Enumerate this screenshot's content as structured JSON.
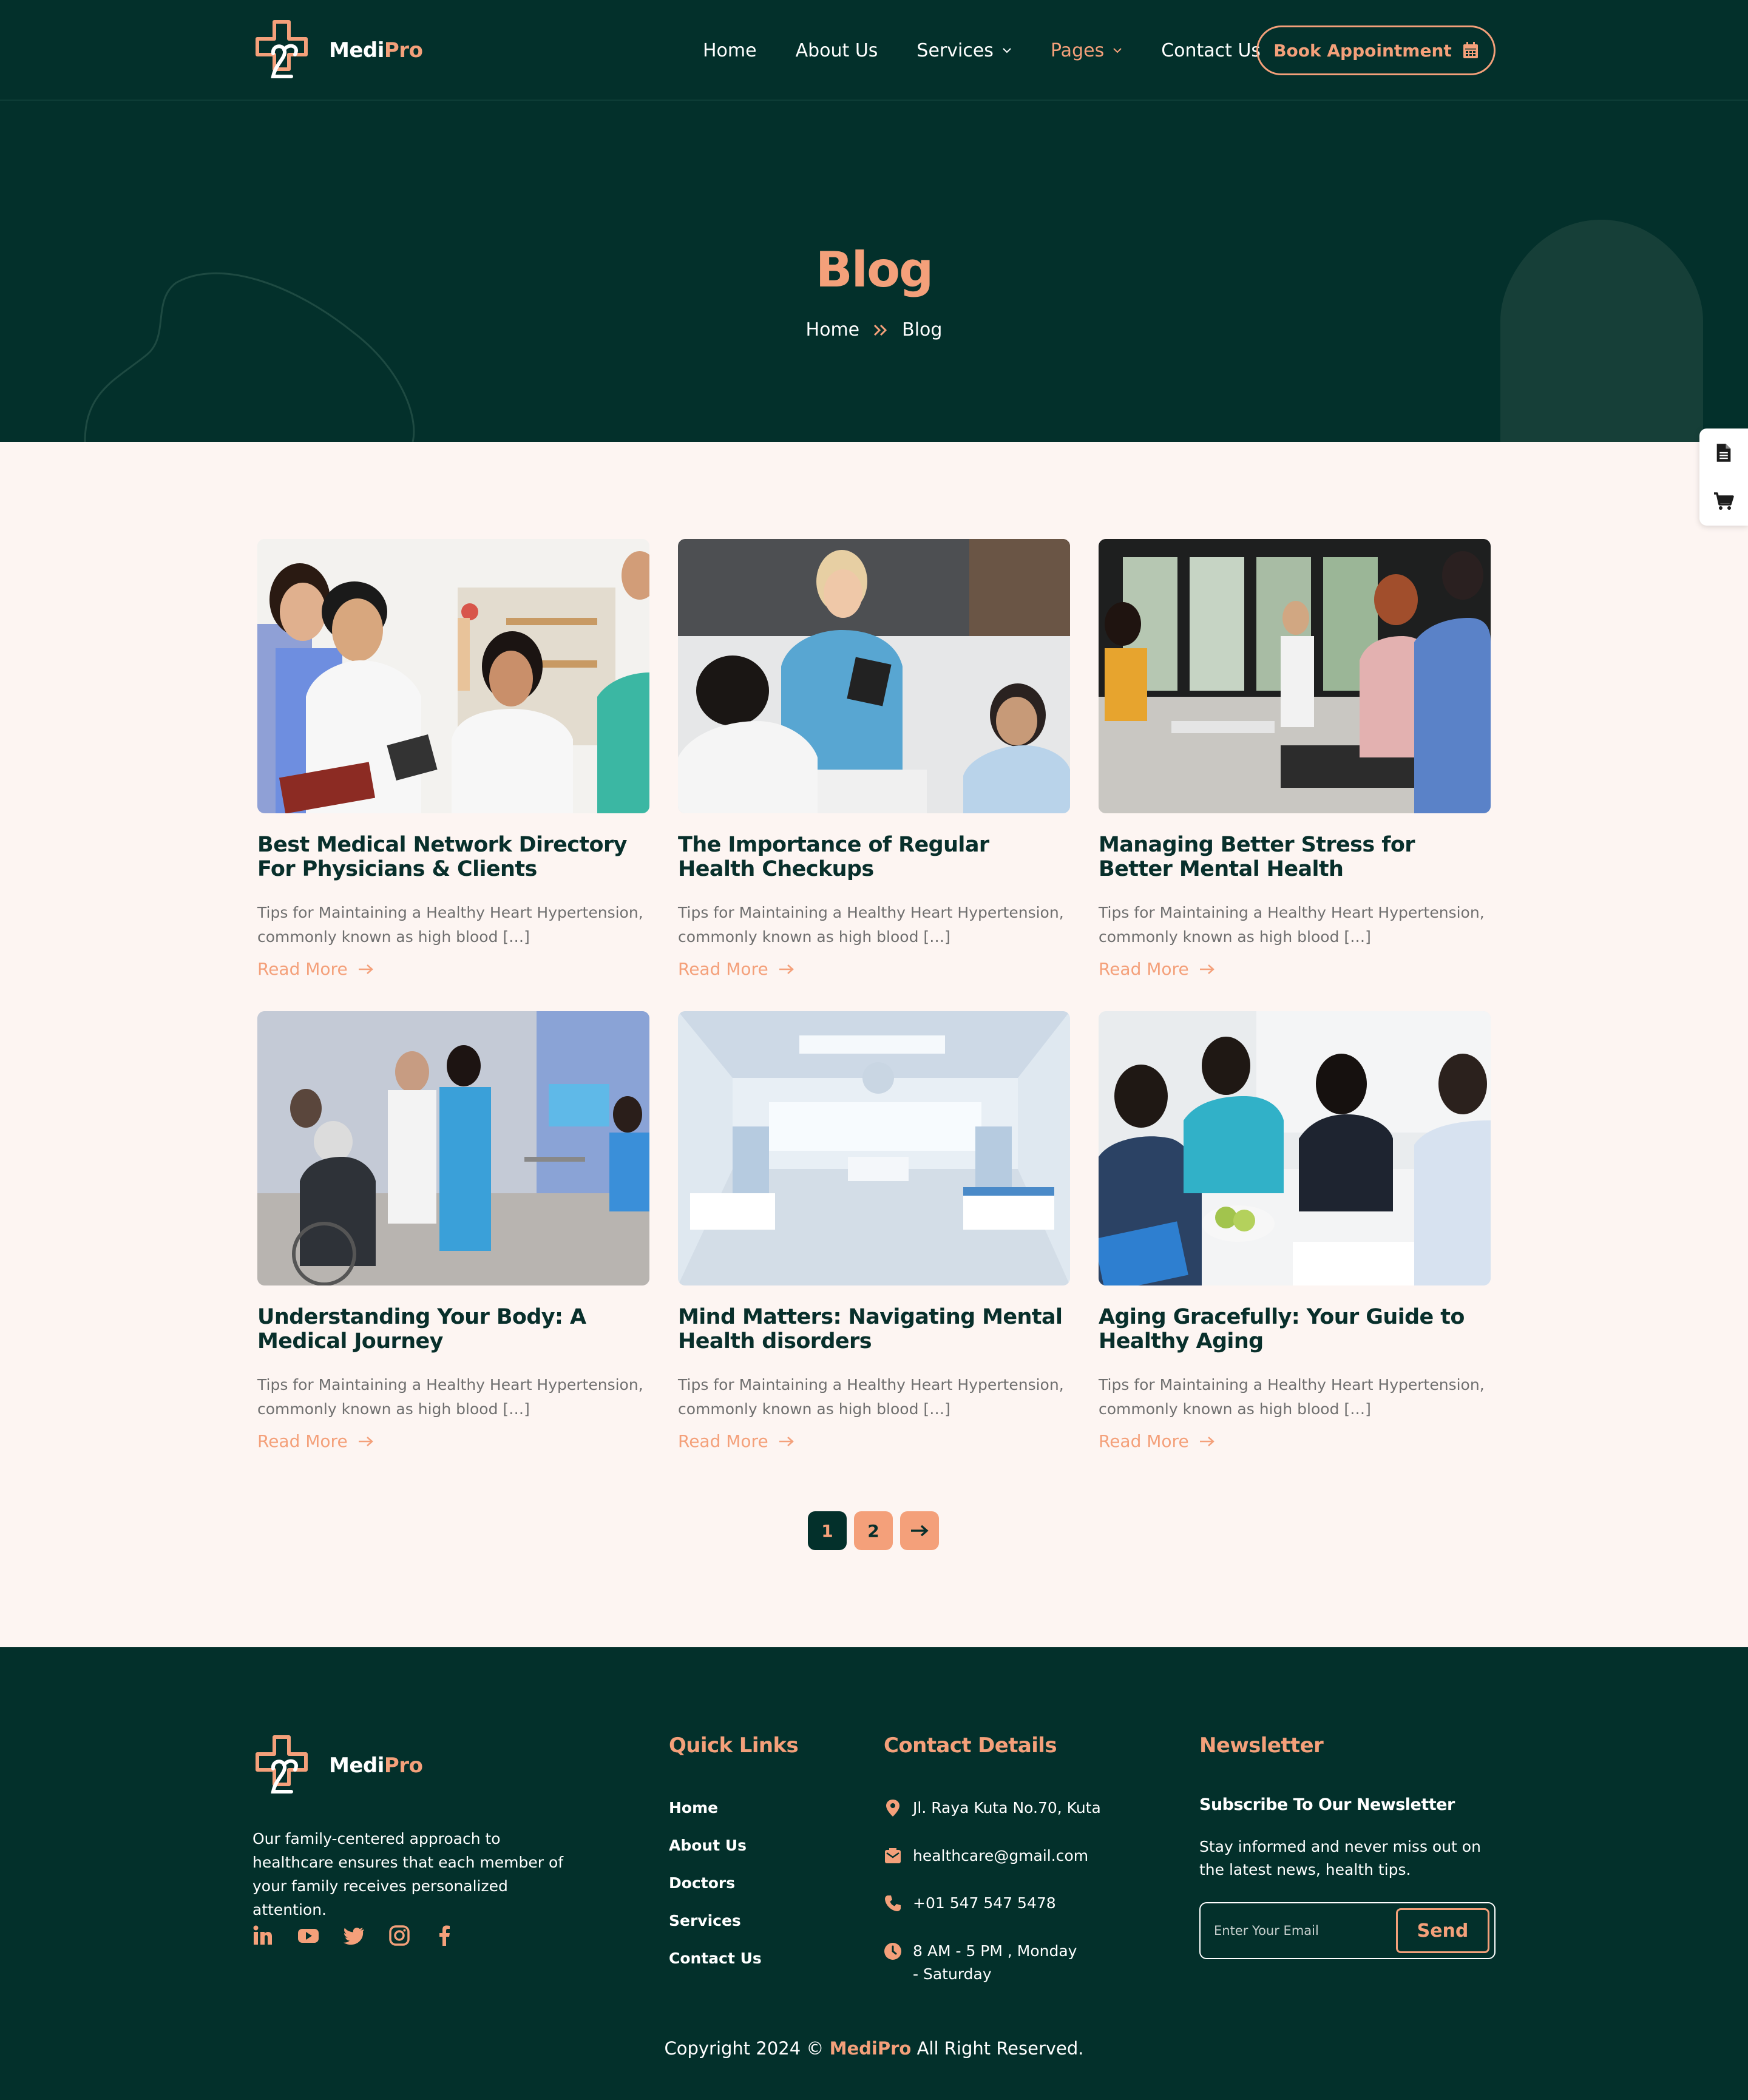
{
  "brand": {
    "name_main": "Medi",
    "name_accent": "Pro",
    "accent_color": "#f4a07a",
    "dark_color": "#03302b"
  },
  "nav": {
    "items": [
      {
        "label": "Home"
      },
      {
        "label": "About Us"
      },
      {
        "label": "Services"
      },
      {
        "label": "Pages"
      },
      {
        "label": "Contact Us"
      }
    ],
    "cta_label": "Book Appointment",
    "cta_icon": "calendar-icon"
  },
  "hero": {
    "title": "Blog",
    "breadcrumb": {
      "home": "Home",
      "current": "Blog"
    }
  },
  "side_widget": {
    "icons": [
      "document-icon",
      "cart-icon"
    ]
  },
  "posts": [
    {
      "title": "Best Medical Network Directory For Physicians & Clients",
      "excerpt": "Tips for Maintaining a Healthy Heart Hypertension, commonly known as high blood […]",
      "link": "Read More",
      "image": "doctors-with-tablet-photo"
    },
    {
      "title": "The Importance of Regular Health Checkups",
      "excerpt": "Tips for Maintaining a Healthy Heart Hypertension, commonly known as high blood […]",
      "link": "Read More",
      "image": "nurse-briefing-photo"
    },
    {
      "title": "Managing Better Stress for Better Mental Health",
      "excerpt": "Tips for Maintaining a Healthy Heart Hypertension, commonly known as high blood […]",
      "link": "Read More",
      "image": "waiting-room-photo"
    },
    {
      "title": "Understanding Your Body: A Medical Journey",
      "excerpt": "Tips for Maintaining a Healthy Heart Hypertension, commonly known as high blood […]",
      "link": "Read More",
      "image": "clinic-wheelchair-photo"
    },
    {
      "title": "Mind Matters: Navigating Mental Health disorders",
      "excerpt": "Tips for Maintaining a Healthy Heart Hypertension, commonly known as high blood […]",
      "link": "Read More",
      "image": "hospital-ward-photo"
    },
    {
      "title": "Aging Gracefully: Your Guide to Healthy Aging",
      "excerpt": "Tips for Maintaining a Healthy Heart Hypertension, commonly known as high blood […]",
      "link": "Read More",
      "image": "handshake-meeting-photo"
    }
  ],
  "pagination": {
    "pages": [
      "1",
      "2"
    ],
    "current": "1"
  },
  "footer": {
    "about": "Our family-centered approach to healthcare ensures that each member of your family receives personalized attention.",
    "socials": [
      "linkedin-icon",
      "youtube-icon",
      "twitter-icon",
      "instagram-icon",
      "facebook-icon"
    ],
    "quick_links": {
      "heading": "Quick Links",
      "items": [
        "Home",
        "About Us",
        "Doctors",
        "Services",
        "Contact Us"
      ]
    },
    "contact": {
      "heading": "Contact Details",
      "address": "Jl. Raya Kuta No.70, Kuta",
      "email": "healthcare@gmail.com",
      "phone": "+01 547 547 5478",
      "hours": "8 AM - 5 PM , Monday - Saturday"
    },
    "newsletter": {
      "heading": "Newsletter",
      "subheading": "Subscribe To Our Newsletter",
      "text": "Stay informed and never miss out on the latest news, health tips.",
      "placeholder": "Enter Your Email",
      "button": "Send"
    },
    "copyright_prefix": "Copyright 2024 ©",
    "copyright_brand": "MediPro",
    "copyright_suffix": "All Right Reserved."
  }
}
